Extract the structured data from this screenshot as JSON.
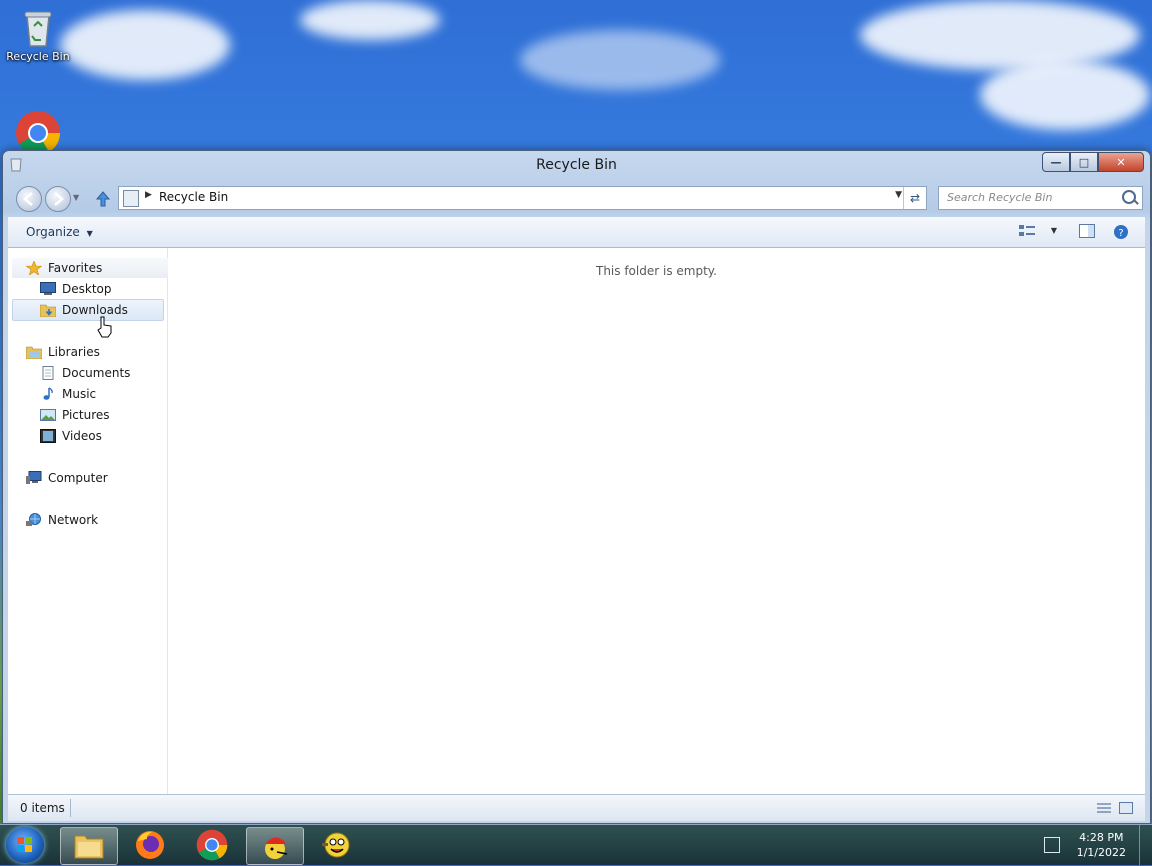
{
  "desktop": {
    "recycle_bin_label": "Recycle Bin"
  },
  "window": {
    "title": "Recycle Bin",
    "address": {
      "path": "Recycle Bin"
    },
    "search": {
      "placeholder": "Search Recycle Bin"
    },
    "toolbar": {
      "organize_label": "Organize"
    },
    "navpane": {
      "favorites": {
        "label": "Favorites",
        "items": [
          "Desktop",
          "Downloads"
        ]
      },
      "libraries": {
        "label": "Libraries",
        "items": [
          "Documents",
          "Music",
          "Pictures",
          "Videos"
        ]
      },
      "computer": "Computer",
      "network": "Network",
      "selected": "Downloads"
    },
    "content": {
      "empty_message": "This folder is empty."
    },
    "status": {
      "item_count": "0 items"
    }
  },
  "taskbar": {
    "apps": [
      "start-orb",
      "windows-explorer",
      "firefox",
      "chrome",
      "app-red-cap",
      "app-smiley"
    ],
    "active_app": "windows-explorer",
    "clock": {
      "time": "4:28 PM",
      "date": "1/1/2022"
    }
  },
  "colors": {
    "window_frame": "#c6d8ee",
    "selection": "#dbe8f6",
    "close_button": "#c4442a",
    "taskbar": "#1d3252"
  }
}
